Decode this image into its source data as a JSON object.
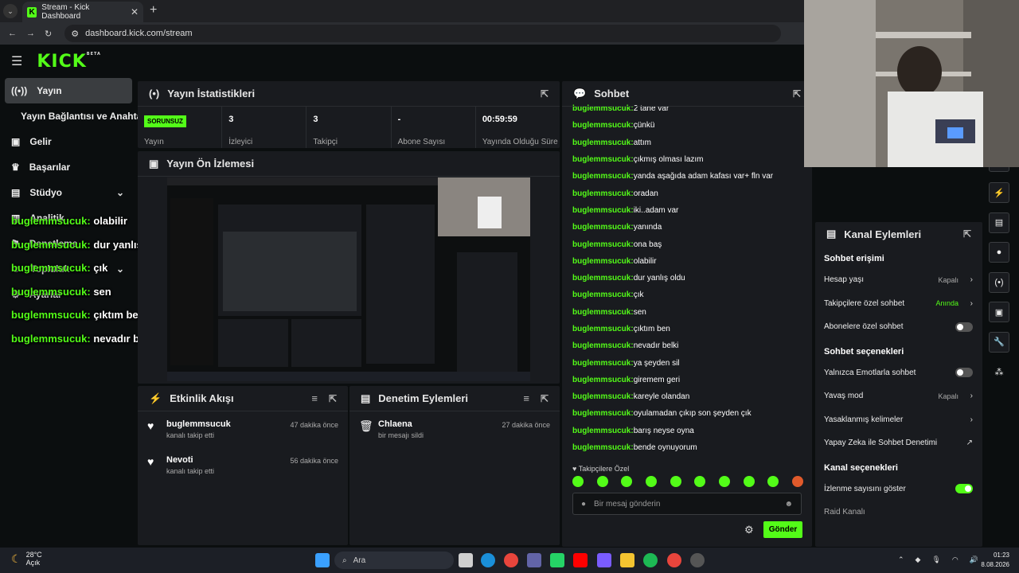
{
  "browser": {
    "tab_title": "Stream - Kick Dashboard",
    "url": "dashboard.kick.com/stream"
  },
  "header": {
    "logo": "KICK",
    "logo_badge": "BETA"
  },
  "sidebar": {
    "items": [
      {
        "label": "Yayın",
        "icon": "broadcast-icon"
      },
      {
        "label": "Yayın Bağlantısı ve Anahtarı"
      },
      {
        "label": "Gelir",
        "icon": "revenue-icon"
      },
      {
        "label": "Başarılar",
        "icon": "trophy-icon"
      },
      {
        "label": "Stüdyo",
        "icon": "studio-icon"
      },
      {
        "label": "Analitik",
        "icon": "analytics-icon"
      },
      {
        "label": "Denetleme",
        "icon": "moderation-icon"
      },
      {
        "label": "Topluluk",
        "icon": "community-icon"
      },
      {
        "label": "Ayarlar",
        "icon": "settings-icon"
      }
    ]
  },
  "overlay_chat": [
    {
      "user": "buglemmsucuk",
      "msg": "olabilir"
    },
    {
      "user": "buglemmsucuk",
      "msg": "dur yanlış oldu"
    },
    {
      "user": "buglemmsucuk",
      "msg": "çık"
    },
    {
      "user": "buglemmsucuk",
      "msg": "sen"
    },
    {
      "user": "buglemmsucuk",
      "msg": "çıktım ben"
    },
    {
      "user": "buglemmsucuk",
      "msg": "nevadır belki"
    }
  ],
  "stats": {
    "title": "Yayın İstatistikleri",
    "items": [
      {
        "value": "SORUNSUZ",
        "label": "Yayın"
      },
      {
        "value": "3",
        "label": "İzleyici"
      },
      {
        "value": "3",
        "label": "Takipçi"
      },
      {
        "value": "-",
        "label": "Abone Sayısı"
      },
      {
        "value": "00:59:59",
        "label": "Yayında Olduğu Süre"
      }
    ]
  },
  "preview": {
    "title": "Yayın Ön İzlemesi"
  },
  "activity": {
    "title": "Etkinlik Akışı",
    "items": [
      {
        "name": "buglemmsucuk",
        "desc": "kanalı takip etti",
        "time": "47 dakika önce"
      },
      {
        "name": "Nevoti",
        "desc": "kanalı takip etti",
        "time": "56 dakika önce"
      }
    ]
  },
  "moderation": {
    "title": "Denetim Eylemleri",
    "items": [
      {
        "name": "Chlaena",
        "desc": "bir mesajı sildi",
        "time": "27 dakika önce"
      }
    ]
  },
  "chat": {
    "title": "Sohbet",
    "messages": [
      {
        "user": "buglemmsucuk",
        "msg": "2 tane var"
      },
      {
        "user": "buglemmsucuk",
        "msg": "çünkü"
      },
      {
        "user": "buglemmsucuk",
        "msg": "attım"
      },
      {
        "user": "buglemmsucuk",
        "msg": "çıkmış olması lazım"
      },
      {
        "user": "buglemmsucuk",
        "msg": "yanda aşağıda adam kafası var+ fln var"
      },
      {
        "user": "buglemmsucuk",
        "msg": "oradan"
      },
      {
        "user": "buglemmsucuk",
        "msg": "iki..adam var"
      },
      {
        "user": "buglemmsucuk",
        "msg": "yanında"
      },
      {
        "user": "buglemmsucuk",
        "msg": "ona baş"
      },
      {
        "user": "buglemmsucuk",
        "msg": "olabilir"
      },
      {
        "user": "buglemmsucuk",
        "msg": "dur yanlış oldu"
      },
      {
        "user": "buglemmsucuk",
        "msg": "çık"
      },
      {
        "user": "buglemmsucuk",
        "msg": "sen"
      },
      {
        "user": "buglemmsucuk",
        "msg": "çıktım ben"
      },
      {
        "user": "buglemmsucuk",
        "msg": "nevadır belki"
      },
      {
        "user": "buglemmsucuk",
        "msg": "ya şeyden sil"
      },
      {
        "user": "buglemmsucuk",
        "msg": "giremem geri"
      },
      {
        "user": "buglemmsucuk",
        "msg": "kareyle olandan"
      },
      {
        "user": "buglemmsucuk",
        "msg": "oyulamadan çıkıp son şeyden çık"
      },
      {
        "user": "buglemmsucuk",
        "msg": "barış neyse oyna"
      },
      {
        "user": "buglemmsucuk",
        "msg": "bende oynuyorum"
      }
    ],
    "followers_only": "Takipçilere Özel",
    "input_placeholder": "Bir mesaj gönderin",
    "send_label": "Gönder"
  },
  "channel_actions": {
    "title": "Kanal Eylemleri",
    "sections": {
      "access": "Sohbet erişimi",
      "options": "Sohbet seçenekleri",
      "channel": "Kanal seçenekleri"
    },
    "rows": {
      "account_age": {
        "label": "Hesap yaşı",
        "value": "Kapalı"
      },
      "followers_chat": {
        "label": "Takipçilere özel sohbet",
        "value": "Anında"
      },
      "subs_chat": {
        "label": "Abonelere özel sohbet",
        "on": false
      },
      "emote_only": {
        "label": "Yalnızca Emotlarla sohbet",
        "on": false
      },
      "slow_mode": {
        "label": "Yavaş mod",
        "value": "Kapalı"
      },
      "banned_words": {
        "label": "Yasaklanmış kelimeler"
      },
      "ai_mod": {
        "label": "Yapay Zeka ile Sohbet Denetimi"
      },
      "show_viewers": {
        "label": "İzlenme sayısını göster",
        "on": true
      },
      "raid": {
        "label": "Raid Kanalı"
      }
    }
  },
  "taskbar": {
    "temp": "28°C",
    "weather": "Açık",
    "search": "Ara",
    "time": "01:23",
    "date": "8.08.2026"
  }
}
